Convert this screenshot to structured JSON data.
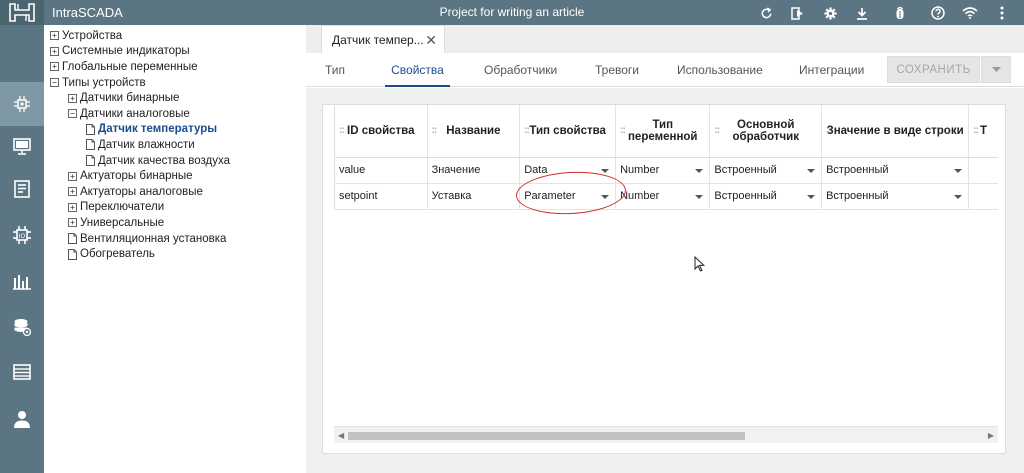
{
  "app": {
    "title": "IntraSCADA",
    "project": "Project for writing an article"
  },
  "topbar_icons": [
    "refresh-icon",
    "exit-run-icon",
    "settings-icon",
    "download-icon",
    "bug-icon",
    "help-icon",
    "wifi-icon",
    "more-vertical-icon"
  ],
  "rail": [
    {
      "name": "devices-icon",
      "active": true
    },
    {
      "name": "monitor-icon",
      "active": false
    },
    {
      "name": "reports-icon",
      "active": false
    },
    {
      "name": "network-icon",
      "active": false
    },
    {
      "name": "charts-icon",
      "active": false
    },
    {
      "name": "database-icon",
      "active": false
    },
    {
      "name": "archive-icon",
      "active": false
    },
    {
      "name": "user-icon",
      "active": false
    }
  ],
  "tree": [
    {
      "label": "Устройства",
      "level": 0,
      "toggle": "+"
    },
    {
      "label": "Системные индикаторы",
      "level": 0,
      "toggle": "+"
    },
    {
      "label": "Глобальные переменные",
      "level": 0,
      "toggle": "+"
    },
    {
      "label": "Типы устройств",
      "level": 0,
      "toggle": "−"
    },
    {
      "label": "Датчики бинарные",
      "level": 1,
      "toggle": "+"
    },
    {
      "label": "Датчики аналоговые",
      "level": 1,
      "toggle": "−"
    },
    {
      "label": "Датчик температуры",
      "level": 2,
      "toggle": "doc",
      "selected": true
    },
    {
      "label": "Датчик влажности",
      "level": 2,
      "toggle": "doc"
    },
    {
      "label": "Датчик качества воздуха",
      "level": 2,
      "toggle": "doc"
    },
    {
      "label": "Актуаторы бинарные",
      "level": 1,
      "toggle": "+"
    },
    {
      "label": "Актуаторы аналоговые",
      "level": 1,
      "toggle": "+"
    },
    {
      "label": "Переключатели",
      "level": 1,
      "toggle": "+"
    },
    {
      "label": "Универсальные",
      "level": 1,
      "toggle": "+"
    },
    {
      "label": "Вентиляционная установка",
      "level": 1,
      "toggle": "doc"
    },
    {
      "label": "Обогреватель",
      "level": 1,
      "toggle": "doc"
    }
  ],
  "doc_tab": {
    "label": "Датчик темпер...",
    "close": "✕"
  },
  "subtabs": [
    {
      "label": "Тип",
      "active": false
    },
    {
      "label": "Свойства",
      "active": true
    },
    {
      "label": "Обработчики",
      "active": false
    },
    {
      "label": "Тревоги",
      "active": false
    },
    {
      "label": "Использование",
      "active": false
    },
    {
      "label": "Интеграции",
      "active": false
    }
  ],
  "save_label": "СОХРАНИТЬ",
  "table": {
    "columns": [
      {
        "label": "ID свойства",
        "drag": true
      },
      {
        "label": "Название",
        "drag": true
      },
      {
        "label": "Тип свойства",
        "drag": true
      },
      {
        "label": "Тип переменной",
        "drag": true
      },
      {
        "label": "Основной обработчик",
        "drag": true
      },
      {
        "label": "Значение в виде строки",
        "drag": true
      },
      {
        "label": "Т",
        "drag": true
      }
    ],
    "rows": [
      {
        "id": "value",
        "name": "Значение",
        "prop_type": "Data",
        "var_type": "Number",
        "handler": "Встроенный",
        "string_value": "Встроенный"
      },
      {
        "id": "setpoint",
        "name": "Уставка",
        "prop_type": "Parameter",
        "var_type": "Number",
        "handler": "Встроенный",
        "string_value": "Встроенный"
      }
    ]
  },
  "colors": {
    "header": "#5b7583",
    "rail_active": "#7e98a5",
    "accent": "#1b4e8f",
    "highlight": "#d0302a"
  }
}
